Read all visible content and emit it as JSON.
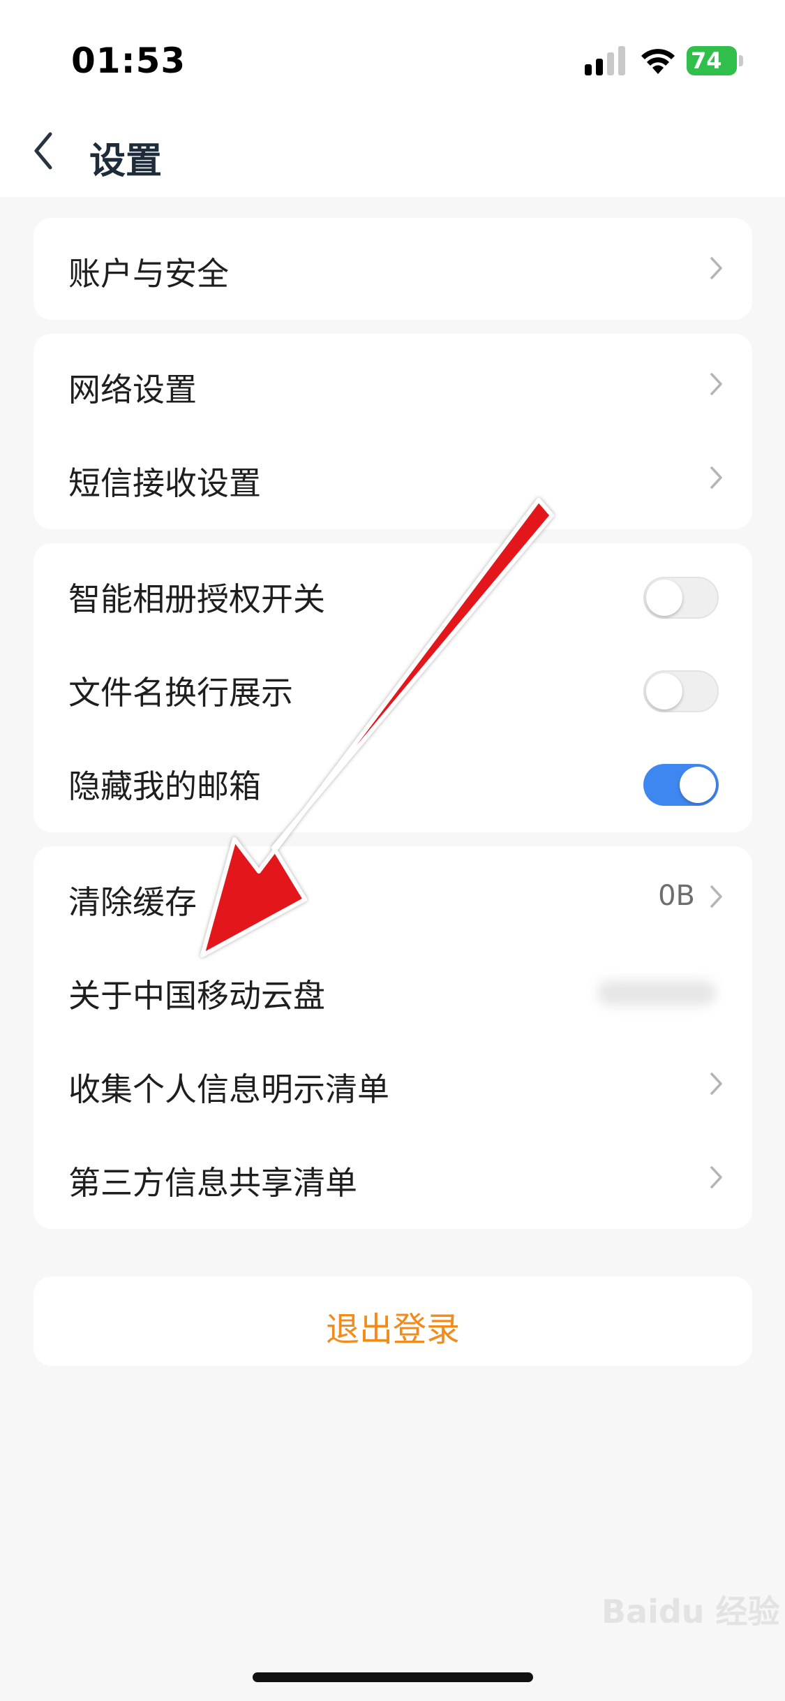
{
  "status_bar": {
    "time": "01:53",
    "battery": "74"
  },
  "nav": {
    "title": "设置"
  },
  "groups": [
    {
      "items": [
        {
          "label": "账户与安全",
          "type": "link"
        }
      ]
    },
    {
      "items": [
        {
          "label": "网络设置",
          "type": "link"
        },
        {
          "label": "短信接收设置",
          "type": "link"
        }
      ]
    },
    {
      "items": [
        {
          "label": "智能相册授权开关",
          "type": "toggle",
          "on": false
        },
        {
          "label": "文件名换行展示",
          "type": "toggle",
          "on": false
        },
        {
          "label": "隐藏我的邮箱",
          "type": "toggle",
          "on": true
        }
      ]
    },
    {
      "items": [
        {
          "label": "清除缓存",
          "type": "link",
          "value": "0B"
        },
        {
          "label": "关于中国移动云盘",
          "type": "blurred"
        },
        {
          "label": "收集个人信息明示清单",
          "type": "link"
        },
        {
          "label": "第三方信息共享清单",
          "type": "link"
        }
      ]
    }
  ],
  "logout": {
    "label": "退出登录"
  },
  "watermark": "Baidu 经验",
  "colors": {
    "accent_orange": "#f28a1c",
    "toggle_on": "#3f87f0",
    "battery_green": "#2fbf4a",
    "annotation_arrow": "#e3121b"
  },
  "icons": {
    "back": "chevron-left-icon",
    "row_link": "chevron-right-icon"
  }
}
